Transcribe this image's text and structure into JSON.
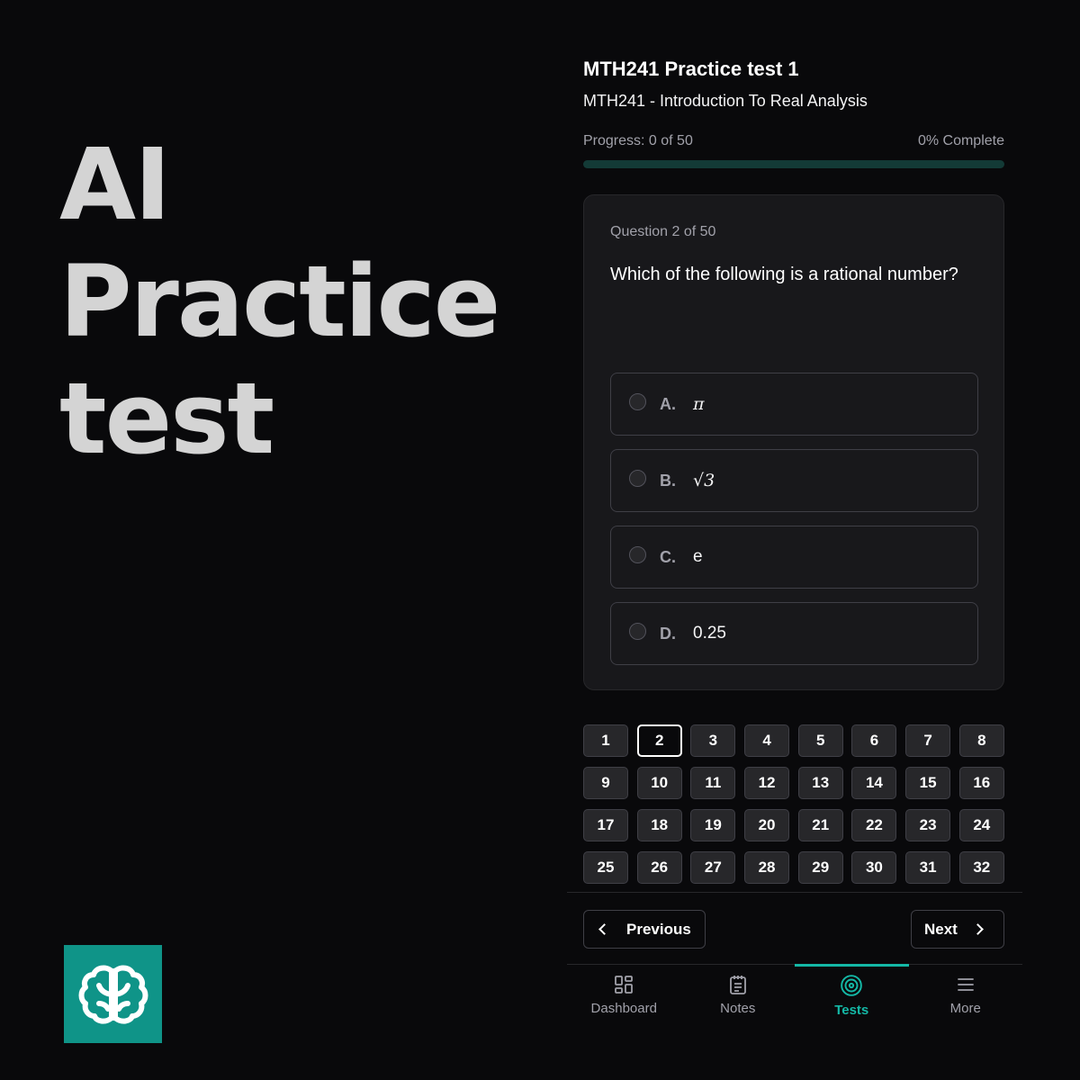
{
  "hero": {
    "lines": [
      "AI",
      "Practice",
      "test"
    ]
  },
  "test": {
    "title": "MTH241 Practice test 1",
    "course": "MTH241 - Introduction To Real Analysis",
    "progress_label": "Progress: 0 of 50",
    "progress_percent_label": "0% Complete",
    "progress_fraction": 0
  },
  "question": {
    "number_label": "Question 2 of 50",
    "text": "Which of the following is a rational number?",
    "options": [
      {
        "letter": "A.",
        "value": "π"
      },
      {
        "letter": "B.",
        "value": "√3"
      },
      {
        "letter": "C.",
        "value": "e"
      },
      {
        "letter": "D.",
        "value": "0.25"
      }
    ]
  },
  "navigator": {
    "buttons": [
      "1",
      "2",
      "3",
      "4",
      "5",
      "6",
      "7",
      "8",
      "9",
      "10",
      "11",
      "12",
      "13",
      "14",
      "15",
      "16",
      "17",
      "18",
      "19",
      "20",
      "21",
      "22",
      "23",
      "24",
      "25",
      "26",
      "27",
      "28",
      "29",
      "30",
      "31",
      "32"
    ],
    "active": "2"
  },
  "controls": {
    "previous_label": "Previous",
    "next_label": "Next"
  },
  "tabs": [
    {
      "label": "Dashboard",
      "icon": "dashboard-icon"
    },
    {
      "label": "Notes",
      "icon": "notes-icon"
    },
    {
      "label": "Tests",
      "icon": "target-icon",
      "active": true
    },
    {
      "label": "More",
      "icon": "menu-icon"
    }
  ],
  "colors": {
    "accent": "#14b8a6",
    "logo_bg": "#0f9488",
    "background": "#09090b",
    "card": "#18181b"
  }
}
